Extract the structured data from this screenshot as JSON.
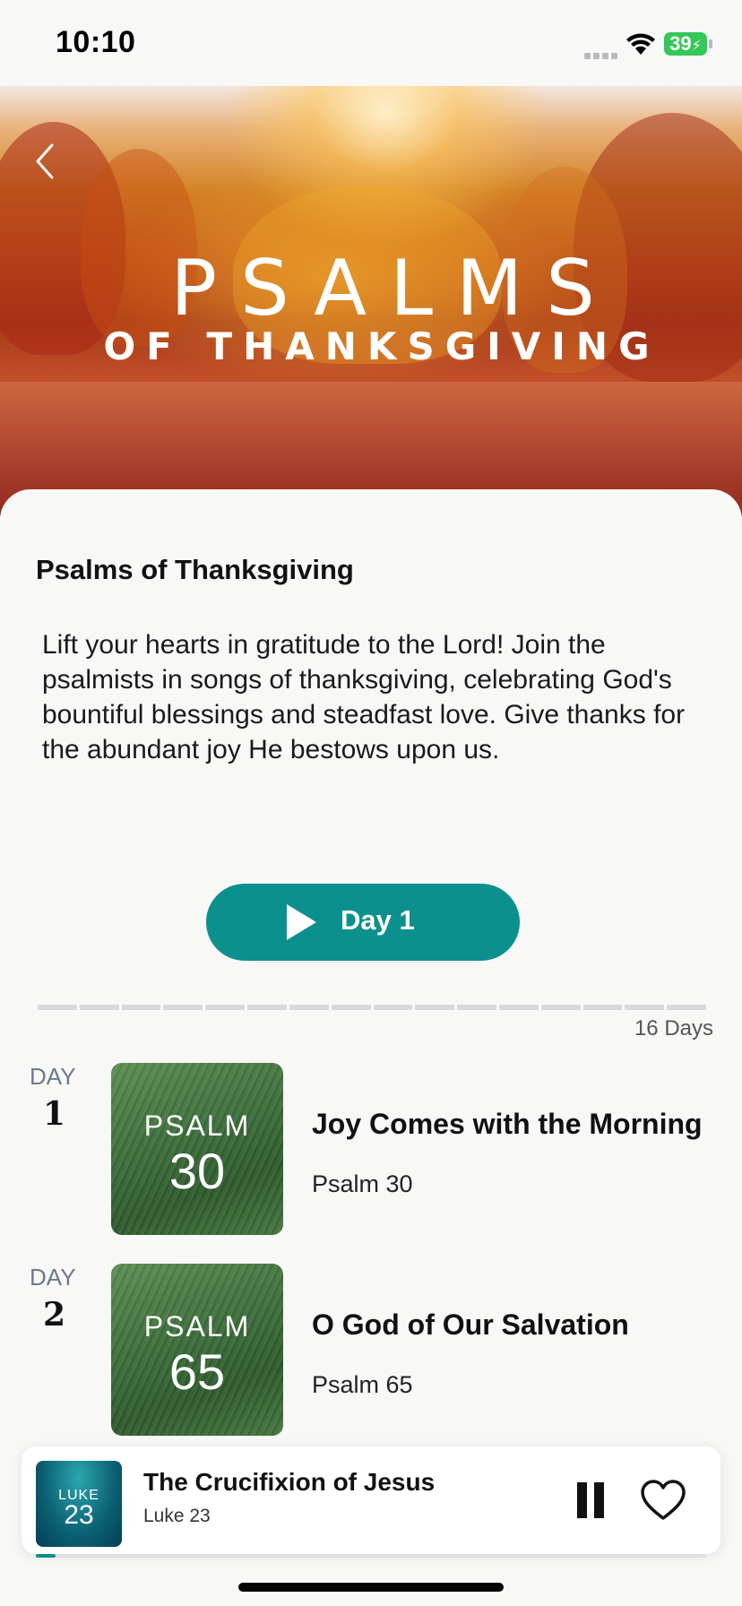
{
  "status_bar": {
    "time": "10:10",
    "battery": "39"
  },
  "hero": {
    "title_line1": "PSALMS",
    "title_line2": "OF THANKSGIVING"
  },
  "plan": {
    "title": "Psalms of Thanksgiving",
    "description": "Lift your hearts in gratitude to the Lord! Join the psalmists in songs of thanksgiving, celebrating God's bountiful blessings and steadfast love. Give thanks for the abundant joy He bestows upon us.",
    "play_label": "Day 1",
    "days_label": "16 Days",
    "total_days": 16
  },
  "days": [
    {
      "day_label": "DAY",
      "day_number": "1",
      "thumb_line1": "PSALM",
      "thumb_line2": "30",
      "title": "Joy Comes with the Morning",
      "reference": "Psalm 30"
    },
    {
      "day_label": "DAY",
      "day_number": "2",
      "thumb_line1": "PSALM",
      "thumb_line2": "65",
      "title": "O God of Our Salvation",
      "reference": "Psalm 65"
    }
  ],
  "player": {
    "thumb_line1": "LUKE",
    "thumb_line2": "23",
    "title": "The Crucifixion of Jesus",
    "subtitle": "Luke 23",
    "progress_fraction": 0.03
  },
  "colors": {
    "accent": "#0b908d",
    "battery": "#34c759"
  },
  "icons": {
    "back": "chevron-left-icon",
    "play": "play-icon",
    "pause": "pause-icon",
    "favorite": "heart-outline-icon",
    "wifi": "wifi-icon"
  }
}
